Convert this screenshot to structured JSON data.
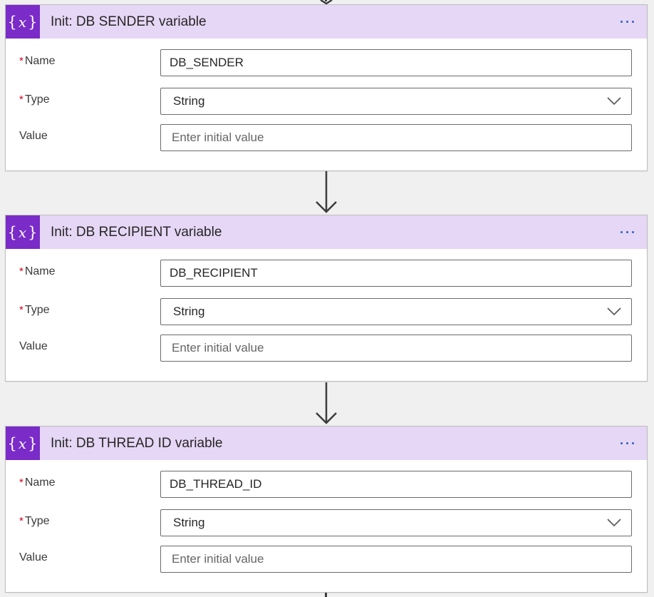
{
  "cards": [
    {
      "title": "Init: DB SENDER variable",
      "icon": "curly-braces-x-icon",
      "icon_text": "{x}",
      "fields": {
        "name_label": "Name",
        "name_value": "DB_SENDER",
        "type_label": "Type",
        "type_value": "String",
        "value_label": "Value",
        "value_placeholder": "Enter initial value"
      }
    },
    {
      "title": "Init: DB RECIPIENT variable",
      "icon": "curly-braces-x-icon",
      "icon_text": "{x}",
      "fields": {
        "name_label": "Name",
        "name_value": "DB_RECIPIENT",
        "type_label": "Type",
        "type_value": "String",
        "value_label": "Value",
        "value_placeholder": "Enter initial value"
      }
    },
    {
      "title": "Init: DB THREAD ID variable",
      "icon": "curly-braces-x-icon",
      "icon_text": "{x}",
      "fields": {
        "name_label": "Name",
        "name_value": "DB_THREAD_ID",
        "type_label": "Type",
        "type_value": "String",
        "value_label": "Value",
        "value_placeholder": "Enter initial value"
      }
    }
  ],
  "required_marker": "*",
  "colors": {
    "header_bg": "#e5d7f5",
    "icon_bg": "#7a2bc8",
    "more_dots": "#2d5fc4",
    "required": "#d0021b"
  }
}
